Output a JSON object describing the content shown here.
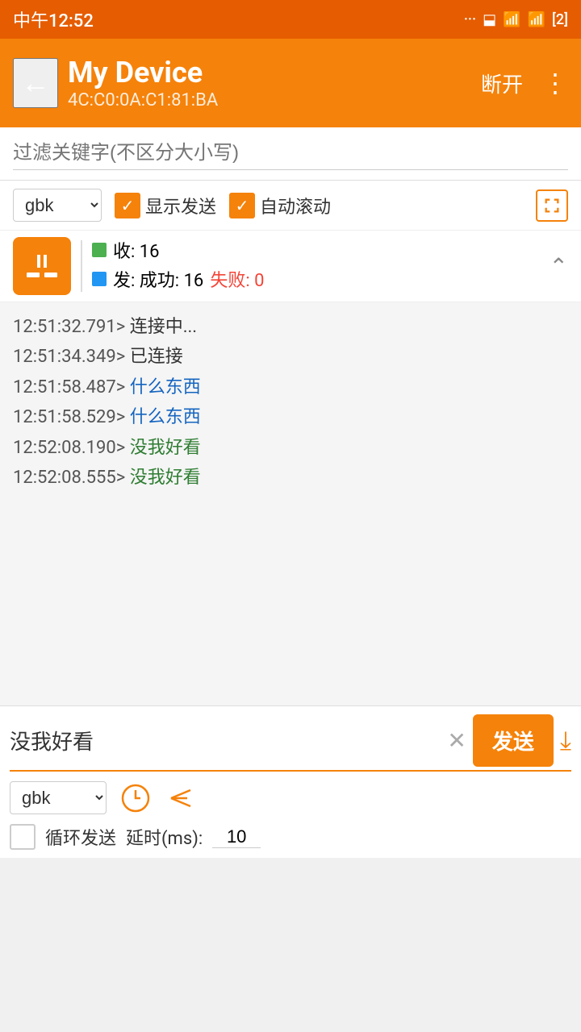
{
  "statusBar": {
    "time": "中午12:52",
    "battery": "2"
  },
  "toolbar": {
    "title": "My Device",
    "subtitle": "4C:C0:0A:C1:81:BA",
    "disconnectLabel": "断开",
    "moreLabel": "⋮"
  },
  "filter": {
    "placeholder": "过滤关键字(不区分大小写)"
  },
  "controls": {
    "encoding": "gbk",
    "showSendLabel": "显示发送",
    "autoScrollLabel": "自动滚动"
  },
  "stats": {
    "receivedLabel": "收: 16",
    "sentSuccessLabel": "发: 成功: 16",
    "sentFailLabel": "失败: 0"
  },
  "logs": [
    {
      "timestamp": "12:51:32.791>",
      "message": "连接中...",
      "color": "default"
    },
    {
      "timestamp": "12:51:34.349>",
      "message": "已连接",
      "color": "default"
    },
    {
      "timestamp": "12:51:58.487>",
      "message": "什么东西",
      "color": "blue"
    },
    {
      "timestamp": "12:51:58.529>",
      "message": "什么东西",
      "color": "blue"
    },
    {
      "timestamp": "12:52:08.190>",
      "message": "没我好看",
      "color": "green"
    },
    {
      "timestamp": "12:52:08.555>",
      "message": "没我好看",
      "color": "green"
    }
  ],
  "bottomInput": {
    "value": "没我好看",
    "sendLabel": "发送",
    "encodingBottom": "gbk",
    "loopLabel": "循环发送",
    "delayLabel": "延时(ms):",
    "delayValue": "10"
  }
}
